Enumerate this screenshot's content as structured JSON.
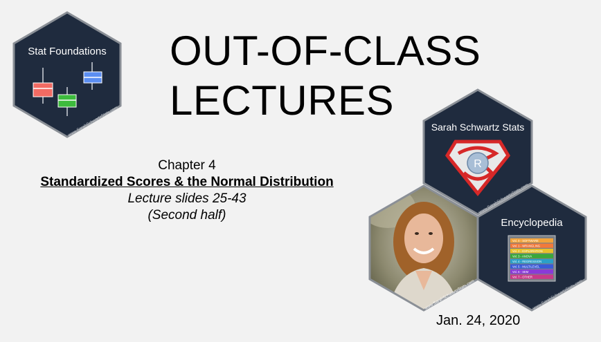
{
  "slide": {
    "title_line1": "OUT-OF-CLASS",
    "title_line2": "LECTURES",
    "chapter": "Chapter 4",
    "subtitle": "Standardized Scores & the Normal Distribution",
    "slides": "Lecture slides 25-43",
    "part": "(Second half)",
    "date": "Jan. 24, 2020"
  },
  "stickers": {
    "stat_foundations": {
      "label": "Stat Foundations",
      "url": "www.SarahSchwartzStats.com"
    },
    "sss": {
      "label": "Sarah Schwartz Stats",
      "url": "www.SarahSchwartzStats.com",
      "logo_letter": "R"
    },
    "encyclopedia": {
      "label": "Encyclopedia",
      "url": "www.SarahSchwartzStats.com",
      "volumes": [
        "Vol. 0 - SOFTWARE",
        "Vol. 1 - WRANGLING",
        "Vol. 2 - EXPLORATION",
        "Vol. 3 - ANOVA",
        "Vol. 4 - REGRESSION",
        "Vol. 5 - MULTILEVEL",
        "Vol. 6 - SEM",
        "Vol. 7 - OTHER"
      ]
    },
    "photo": {
      "url": "www.SarahSchwartzStats.com"
    }
  },
  "colors": {
    "hex_fill": "#1f2b3e",
    "hex_border": "#8a8f96",
    "box_red": "#f26b63",
    "box_green": "#3dbb3d",
    "box_blue": "#5b8ef2",
    "volume_colors": [
      "#f2a33a",
      "#f27a3a",
      "#e8c02a",
      "#3aa83a",
      "#2aa0c8",
      "#3a5ad8",
      "#8a3ad8",
      "#c83a8a"
    ]
  }
}
